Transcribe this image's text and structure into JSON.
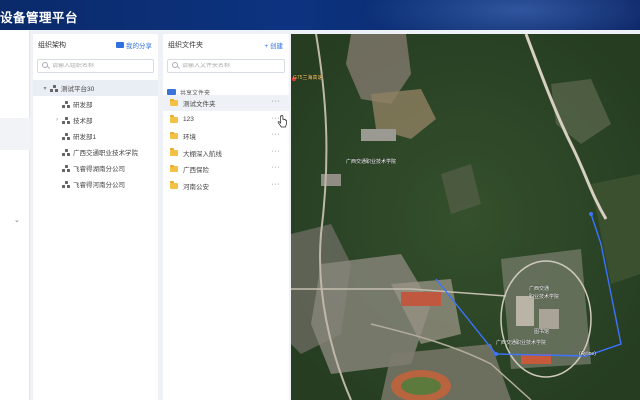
{
  "header": {
    "title": "设备管理平台"
  },
  "sidebar": {
    "expand_icon": "chevron-down-icon"
  },
  "org_panel": {
    "title": "组织架构",
    "my_share_label": "我的分享",
    "search_placeholder": "请输入组织名称",
    "tree": [
      {
        "label": "测试平台30",
        "level": 0,
        "expanded": true,
        "selected": true
      },
      {
        "label": "研发部",
        "level": 1,
        "expandable": false
      },
      {
        "label": "技术部",
        "level": 1,
        "expandable": true
      },
      {
        "label": "研发部1",
        "level": 1,
        "expandable": false
      },
      {
        "label": "广西交通职业技术学院",
        "level": 1,
        "expandable": false
      },
      {
        "label": "飞睿得湖南分公司",
        "level": 1,
        "expandable": false
      },
      {
        "label": "飞睿得河南分公司",
        "level": 1,
        "expandable": false
      }
    ]
  },
  "folder_panel": {
    "title": "组织文件夹",
    "create_label": "+ 创建",
    "search_placeholder": "请输入文件夹名称",
    "shared_label": "共享文件夹",
    "folders": [
      {
        "name": "测试文件夹",
        "more": "···"
      },
      {
        "name": "123",
        "more": "···"
      },
      {
        "name": "环境",
        "more": "···"
      },
      {
        "name": "大棚深入航线",
        "more": "···"
      },
      {
        "name": "广西保险",
        "more": "···"
      },
      {
        "name": "河南公安",
        "more": "···"
      }
    ]
  },
  "map": {
    "labels": {
      "top_road": "G75兰海高速",
      "mid": "广西交通职业技术学院",
      "center_top": "广西交通",
      "center_bottom": "职业技术学院",
      "inner": "图书馆",
      "line_label": "广西交通职业技术学院",
      "bottom_right": "(Ayline)"
    },
    "colors": {
      "route": "#3c73ff",
      "vegetation": "#2f4a2a"
    }
  }
}
